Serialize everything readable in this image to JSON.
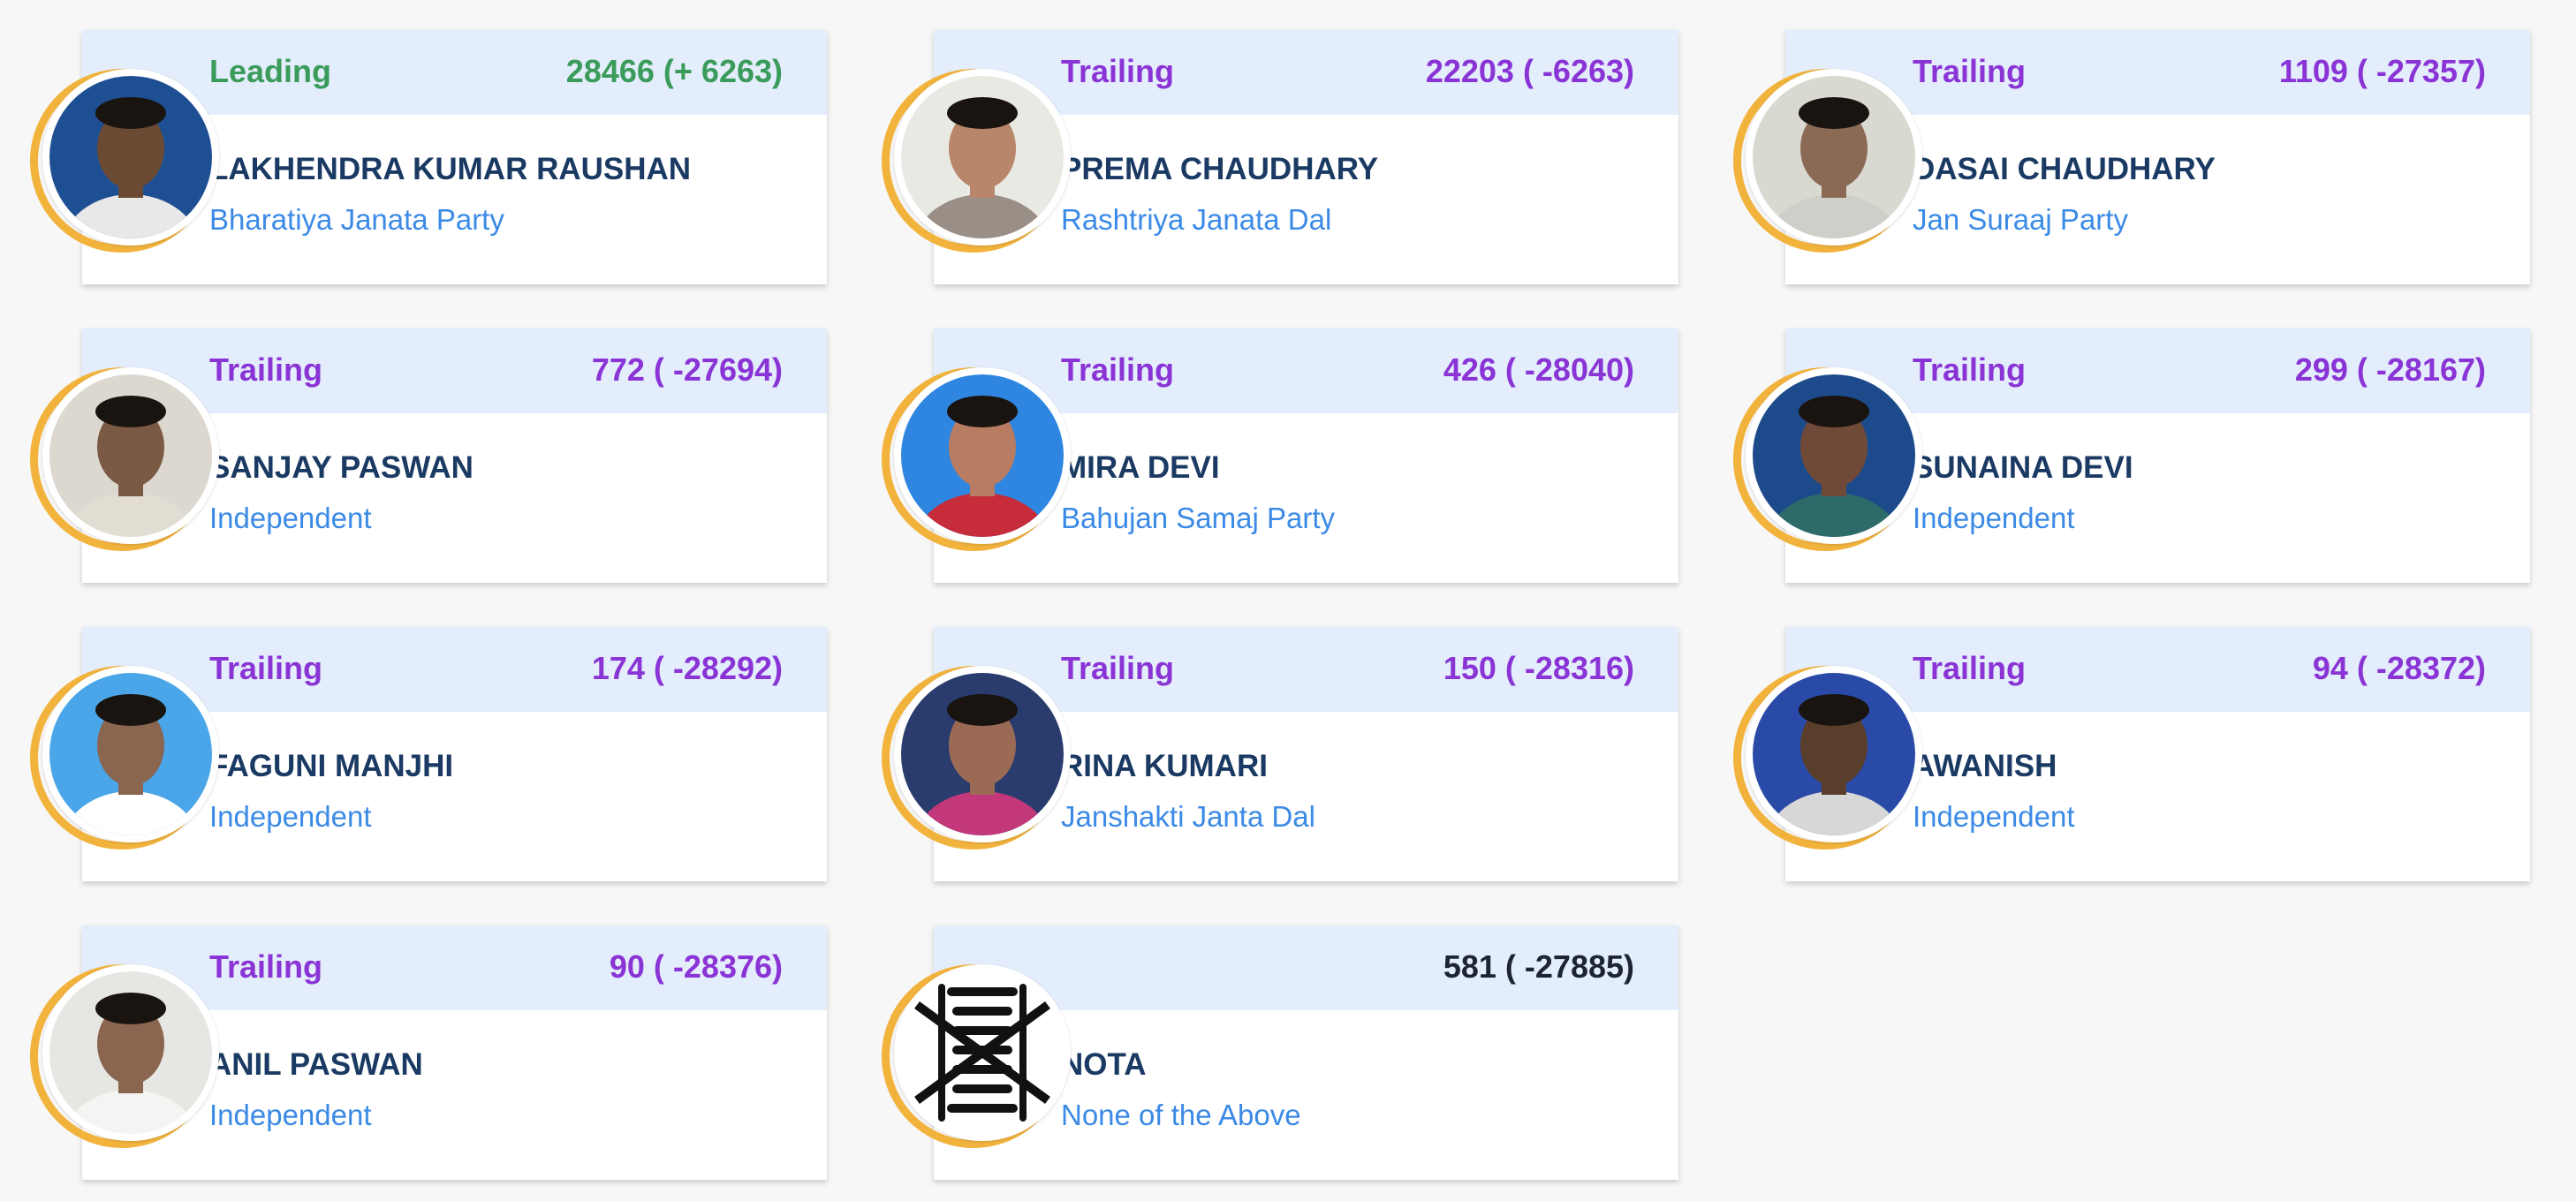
{
  "candidates": [
    {
      "status": "Leading",
      "status_type": "leading",
      "votes": "28466 (+ 6263)",
      "name": "LAKHENDRA KUMAR RAUSHAN",
      "party": "Bharatiya Janata Party",
      "photo": "candidate-photo",
      "bg": "#1f4f93",
      "skin": "#6b4a33",
      "shirt": "#e8e8e8"
    },
    {
      "status": "Trailing",
      "status_type": "trailing",
      "votes": "22203 ( -6263)",
      "name": "PREMA CHAUDHARY",
      "party": "Rashtriya Janata Dal",
      "photo": "candidate-photo",
      "bg": "#e9e9e4",
      "skin": "#b8866a",
      "shirt": "#9a8f86"
    },
    {
      "status": "Trailing",
      "status_type": "trailing",
      "votes": "1109 ( -27357)",
      "name": "DASAI CHAUDHARY",
      "party": "Jan Suraaj Party",
      "photo": "candidate-photo",
      "bg": "#d9d9d2",
      "skin": "#8a6a55",
      "shirt": "#cfcfc9"
    },
    {
      "status": "Trailing",
      "status_type": "trailing",
      "votes": "772 ( -27694)",
      "name": "SANJAY PASWAN",
      "party": "Independent",
      "photo": "candidate-photo",
      "bg": "#dcd8d0",
      "skin": "#7a5a45",
      "shirt": "#e2ddd2"
    },
    {
      "status": "Trailing",
      "status_type": "trailing",
      "votes": "426 ( -28040)",
      "name": "MIRA DEVI",
      "party": "Bahujan Samaj Party",
      "photo": "candidate-photo",
      "bg": "#2f86e0",
      "skin": "#b77c62",
      "shirt": "#c62c3a"
    },
    {
      "status": "Trailing",
      "status_type": "trailing",
      "votes": "299 ( -28167)",
      "name": "SUNAINA DEVI",
      "party": "Independent",
      "photo": "candidate-photo",
      "bg": "#1d4a8a",
      "skin": "#6f4a38",
      "shirt": "#2c6b6a"
    },
    {
      "status": "Trailing",
      "status_type": "trailing",
      "votes": "174 ( -28292)",
      "name": "FAGUNI MANJHI",
      "party": "Independent",
      "photo": "candidate-photo",
      "bg": "#4aa6e8",
      "skin": "#8a6550",
      "shirt": "#ffffff"
    },
    {
      "status": "Trailing",
      "status_type": "trailing",
      "votes": "150 ( -28316)",
      "name": "RINA KUMARI",
      "party": "Janshakti Janta Dal",
      "photo": "candidate-photo",
      "bg": "#2a3c6e",
      "skin": "#9a6a55",
      "shirt": "#c2387a"
    },
    {
      "status": "Trailing",
      "status_type": "trailing",
      "votes": "94 ( -28372)",
      "name": "AWANISH",
      "party": "Independent",
      "photo": "candidate-photo",
      "bg": "#2a4aa8",
      "skin": "#5a3e2c",
      "shirt": "#d7d7d7"
    },
    {
      "status": "Trailing",
      "status_type": "trailing",
      "votes": "90 ( -28376)",
      "name": "ANIL PASWAN",
      "party": "Independent",
      "photo": "candidate-photo",
      "bg": "#e6e6e2",
      "skin": "#8a6650",
      "shirt": "#f4f4f2"
    },
    {
      "status": "",
      "status_type": "neutral",
      "votes": "581 ( -27885)",
      "name": "NOTA",
      "party": "None of the Above",
      "photo": "nota-symbol-icon",
      "bg": "#ffffff",
      "skin": "",
      "shirt": ""
    }
  ]
}
